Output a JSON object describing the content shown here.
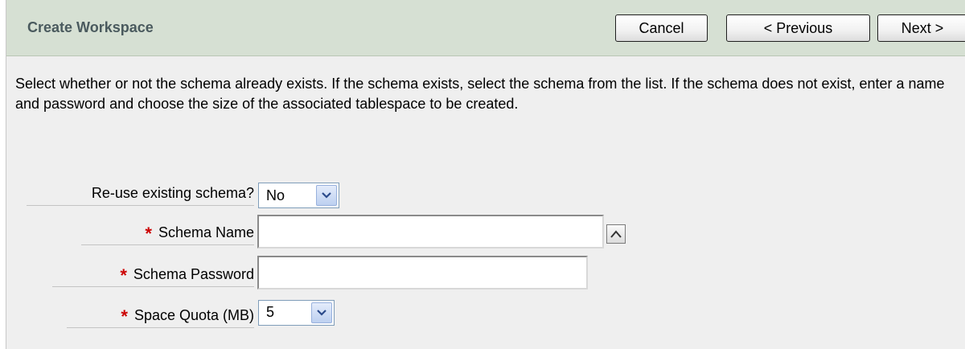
{
  "header": {
    "title": "Create Workspace",
    "cancel_label": "Cancel",
    "previous_label": "< Previous",
    "next_label": "Next >"
  },
  "instructions": "Select whether or not the schema already exists. If the schema exists, select the schema from the list. If the schema does not exist, enter a name and password and choose the size of the associated tablespace to be created.",
  "form": {
    "reuse_schema": {
      "label": "Re-use existing schema?",
      "value": "No"
    },
    "schema_name": {
      "label": "Schema Name",
      "required_marker": "*",
      "value": ""
    },
    "schema_password": {
      "label": "Schema Password",
      "required_marker": "*",
      "value": ""
    },
    "space_quota": {
      "label": "Space Quota (MB)",
      "required_marker": "*",
      "value": "5"
    }
  },
  "colors": {
    "header_bg": "#d6e0d3",
    "body_bg": "#efefef",
    "required": "#cc0000"
  },
  "icons": {
    "dropdown": "chevron-down-icon",
    "list_popup": "caret-up-icon"
  }
}
